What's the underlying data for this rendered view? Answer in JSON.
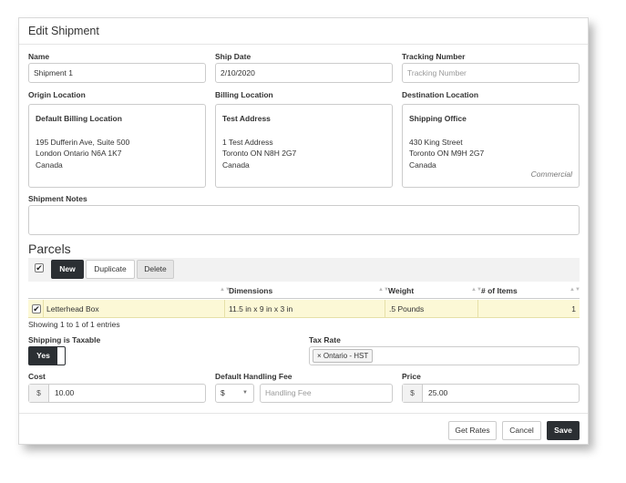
{
  "title": "Edit Shipment",
  "fields": {
    "name_label": "Name",
    "name_value": "Shipment 1",
    "ship_date_label": "Ship Date",
    "ship_date_value": "2/10/2020",
    "tracking_label": "Tracking Number",
    "tracking_placeholder": "Tracking Number"
  },
  "locations": {
    "origin": {
      "label": "Origin Location",
      "name": "Default Billing Location",
      "line1": "195 Dufferin Ave, Suite 500",
      "line2": "London Ontario N6A 1K7",
      "line3": "Canada"
    },
    "billing": {
      "label": "Billing Location",
      "name": "Test Address",
      "line1": "1 Test Address",
      "line2": "Toronto ON N8H 2G7",
      "line3": "Canada"
    },
    "destination": {
      "label": "Destination Location",
      "name": "Shipping Office",
      "line1": "430 King Street",
      "line2": "Toronto ON M9H 2G7",
      "line3": "Canada",
      "tag": "Commercial"
    }
  },
  "notes_label": "Shipment Notes",
  "parcels": {
    "heading": "Parcels",
    "new_label": "New",
    "duplicate_label": "Duplicate",
    "delete_label": "Delete",
    "columns": [
      "",
      "Dimensions",
      "Weight",
      "# of Items"
    ],
    "rows": [
      {
        "name": "Letterhead Box",
        "dimensions": "11.5 in x 9 in x 3 in",
        "weight": ".5 Pounds",
        "items": "1",
        "selected": true
      }
    ],
    "info": "Showing 1 to 1 of 1 entries"
  },
  "taxable": {
    "label": "Shipping is Taxable",
    "value": "Yes"
  },
  "tax_rate": {
    "label": "Tax Rate",
    "chip": "Ontario - HST",
    "chip_remove": "×"
  },
  "cost": {
    "label": "Cost",
    "currency": "$",
    "value": "10.00"
  },
  "handling": {
    "label": "Default Handling Fee",
    "currency": "$",
    "placeholder": "Handling Fee"
  },
  "price": {
    "label": "Price",
    "currency": "$",
    "value": "25.00"
  },
  "buttons": {
    "get_rates": "Get Rates",
    "cancel": "Cancel",
    "save": "Save"
  },
  "icons": {
    "sort": "sort-icon",
    "dropdown": "caret-down-icon",
    "check": "checkmark-icon"
  },
  "colors": {
    "dark": "#2b2f33",
    "row_highlight": "#fcf8d6"
  }
}
